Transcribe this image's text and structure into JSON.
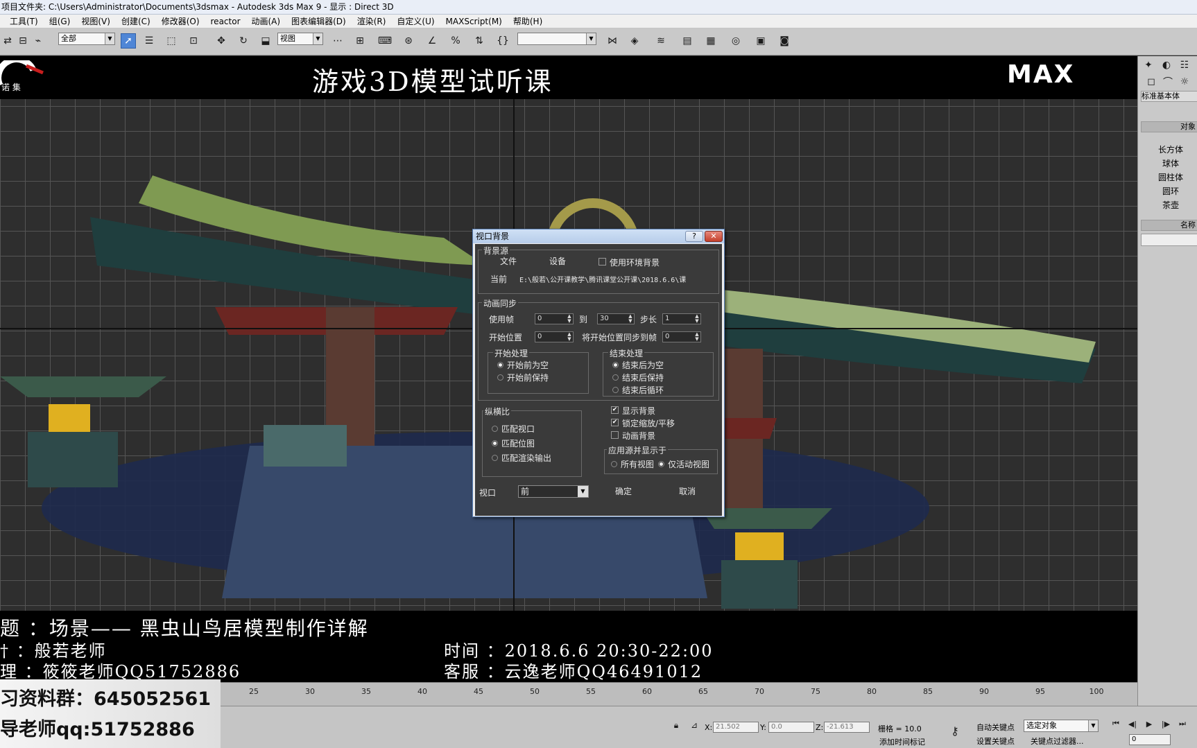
{
  "window": {
    "title": "项目文件夹: C:\\Users\\Administrator\\Documents\\3dsmax      - Autodesk 3ds Max 9      - 显示 : Direct 3D"
  },
  "menu": [
    "工具(T)",
    "组(G)",
    "视图(V)",
    "创建(C)",
    "修改器(O)",
    "reactor",
    "动画(A)",
    "图表编辑器(D)",
    "渲染(R)",
    "自定义(U)",
    "MAXScript(M)",
    "帮助(H)"
  ],
  "toolbar": {
    "selection_filter": "全部",
    "ref_coord": "视图",
    "named_selection": ""
  },
  "viewport": {
    "banner_title": "游戏3D模型试听课",
    "banner_brand": "MAX",
    "logo_text": "诺 集",
    "bottom_lines": {
      "topic": "题 ：场景—— 黑虫山鸟居模型制作详解",
      "lecturer": "† ：般若老师",
      "assistant": "理 ：筱筱老师QQ51752886",
      "time": "时间 ：2018.6.6 20:30-22:00",
      "service": "客服 ：云逸老师QQ46491012"
    }
  },
  "watermark": {
    "line1": "习资料群：645052561",
    "line2": "导老师qq:51752886"
  },
  "timeline": {
    "ticks": [
      "25",
      "30",
      "35",
      "40",
      "45",
      "50",
      "55",
      "60",
      "65",
      "70",
      "75",
      "80",
      "85",
      "90",
      "95",
      "100"
    ]
  },
  "statusbar": {
    "x_label": "X:",
    "x_value": "21.502",
    "y_label": "Y:",
    "y_value": "0.0",
    "z_label": "Z:",
    "z_value": "-21.613",
    "grid": "栅格 = 10.0",
    "add_time_tag": "添加时间标记",
    "auto_key": "自动关键点",
    "set_key": "设置关键点",
    "key_mode": "选定对象",
    "key_filters": "关键点过滤器...",
    "frame": "0"
  },
  "command_panel": {
    "category": "标准基本体",
    "rollout_object_type": "对象",
    "objects": [
      "长方体",
      "球体",
      "圆柱体",
      "圆环",
      "茶壶"
    ],
    "rollout_name": "名称"
  },
  "dialog": {
    "title": "视口背景",
    "help": "?",
    "close": "✕",
    "bg_source_label": "背景源",
    "files_button": "文件",
    "devices_button": "设备",
    "use_env_bg": "使用环境背景",
    "current_label": "当前",
    "current_path": "E:\\般若\\公开课教学\\腾讯课堂公开课\\2018.6.6\\课",
    "anim_sync_label": "动画同步",
    "use_frame_label": "使用帧",
    "use_frame_from": "0",
    "to_label": "到",
    "use_frame_to": "30",
    "step_label": "步长",
    "step_value": "1",
    "start_at_label": "开始位置",
    "start_at_value": "0",
    "sync_start_label": "将开始位置同步到帧",
    "sync_start_value": "0",
    "start_proc_label": "开始处理",
    "blank_before": "开始前为空",
    "hold_before": "开始前保持",
    "end_proc_label": "结束处理",
    "blank_after": "结束后为空",
    "hold_after": "结束后保持",
    "loop_after": "结束后循环",
    "aspect_label": "纵横比",
    "match_viewport": "匹配视口",
    "match_bitmap": "匹配位图",
    "match_render": "匹配渲染输出",
    "display_bg": "显示背景",
    "lock_zoom": "锁定缩放/平移",
    "animate_bg": "动画背景",
    "apply_label": "应用源并显示于",
    "all_views": "所有视图",
    "active_only": "仅活动视图",
    "viewport_label": "视口",
    "viewport_value": "前",
    "ok": "确定",
    "cancel": "取消"
  },
  "colors": {
    "accent": "#4f86d6",
    "viewport_bg": "#2e2e2e",
    "dialog_bg": "#3a3a3a"
  }
}
